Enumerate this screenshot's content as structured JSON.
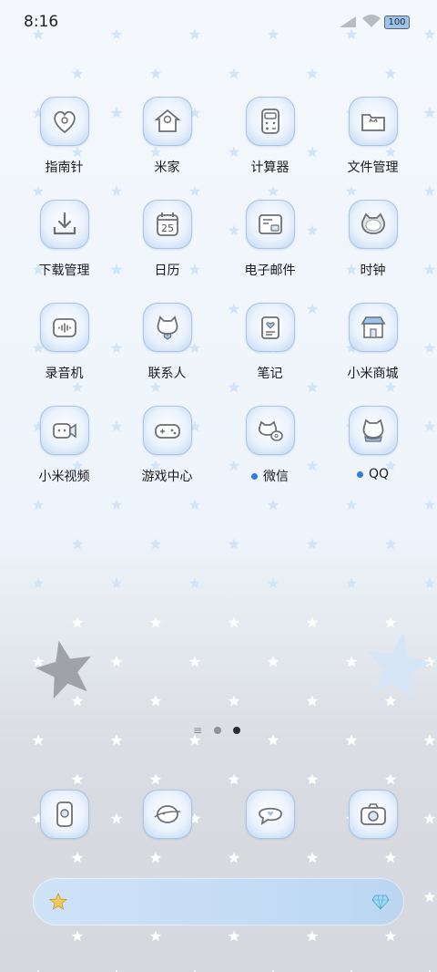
{
  "status_bar": {
    "time": "8:16",
    "battery": "100"
  },
  "apps": [
    {
      "label": "指南针",
      "icon": "compass-heart-icon",
      "dot": false
    },
    {
      "label": "米家",
      "icon": "home-house-icon",
      "dot": false
    },
    {
      "label": "计算器",
      "icon": "calculator-icon",
      "dot": false
    },
    {
      "label": "文件管理",
      "icon": "folder-cat-icon",
      "dot": false
    },
    {
      "label": "下载管理",
      "icon": "download-icon",
      "dot": false
    },
    {
      "label": "日历",
      "icon": "calendar-icon",
      "dot": false,
      "date": "25"
    },
    {
      "label": "电子邮件",
      "icon": "mail-card-icon",
      "dot": false
    },
    {
      "label": "时钟",
      "icon": "cat-clock-icon",
      "dot": false
    },
    {
      "label": "录音机",
      "icon": "recorder-icon",
      "dot": false
    },
    {
      "label": "联系人",
      "icon": "contacts-cat-icon",
      "dot": false
    },
    {
      "label": "笔记",
      "icon": "notes-icon",
      "dot": false
    },
    {
      "label": "小米商城",
      "icon": "store-icon",
      "dot": false
    },
    {
      "label": "小米视频",
      "icon": "video-camera-icon",
      "dot": false
    },
    {
      "label": "游戏中心",
      "icon": "game-controller-icon",
      "dot": false
    },
    {
      "label": "微信",
      "icon": "wechat-cat-icon",
      "dot": true
    },
    {
      "label": "QQ",
      "icon": "qq-cat-icon",
      "dot": true
    }
  ],
  "dock": [
    {
      "icon": "phone-icon"
    },
    {
      "icon": "message-planet-icon"
    },
    {
      "icon": "chat-bubble-icon"
    },
    {
      "icon": "camera-icon"
    }
  ],
  "page_indicator": {
    "pages": 2,
    "active": 2
  },
  "colors": {
    "accent": "#2f7de1",
    "icon_border": "#a9c4e3",
    "search_bar": "#c6dcf5"
  }
}
